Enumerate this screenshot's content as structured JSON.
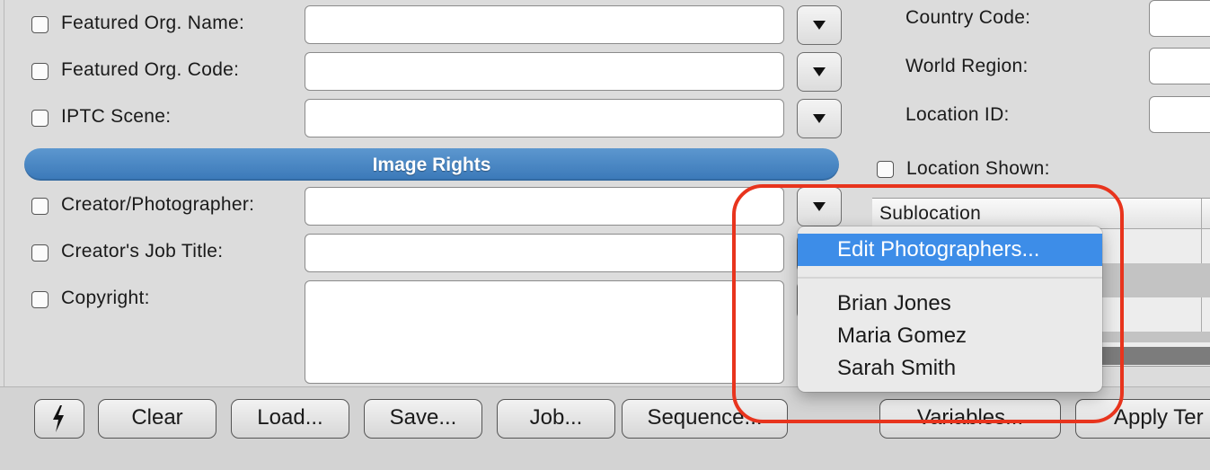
{
  "left_form": {
    "fields": [
      {
        "label": "Featured Org. Name:",
        "value": "",
        "has_dropdown": true
      },
      {
        "label": "Featured Org. Code:",
        "value": "",
        "has_dropdown": true
      },
      {
        "label": "IPTC Scene:",
        "value": "",
        "has_dropdown": true
      }
    ],
    "section_header": "Image Rights",
    "rights_fields": [
      {
        "label": "Creator/Photographer:",
        "value": ""
      },
      {
        "label": "Creator's Job Title:",
        "value": ""
      },
      {
        "label": "Copyright:",
        "value": ""
      }
    ]
  },
  "right_form": {
    "fields": [
      {
        "label": "Country Code:",
        "value": ""
      },
      {
        "label": "World Region:",
        "value": ""
      },
      {
        "label": "Location ID:",
        "value": ""
      }
    ],
    "location_shown_label": "Location Shown:",
    "table": {
      "columns": [
        "Sublocation"
      ]
    }
  },
  "dropdown_menu": {
    "items": [
      {
        "label": "Edit Photographers...",
        "selected": true
      },
      {
        "label": "Brian Jones",
        "selected": false
      },
      {
        "label": "Maria Gomez",
        "selected": false
      },
      {
        "label": "Sarah Smith",
        "selected": false
      }
    ]
  },
  "toolbar": {
    "lightning_icon": "lightning-icon",
    "clear": "Clear",
    "load": "Load...",
    "save": "Save...",
    "job": "Job...",
    "sequence": "Sequence...",
    "variables": "Variables...",
    "apply": "Apply Ter"
  },
  "colors": {
    "section_header": "#4a88c6",
    "menu_selection": "#3d8de8",
    "annotation_outline": "#e8341d"
  }
}
